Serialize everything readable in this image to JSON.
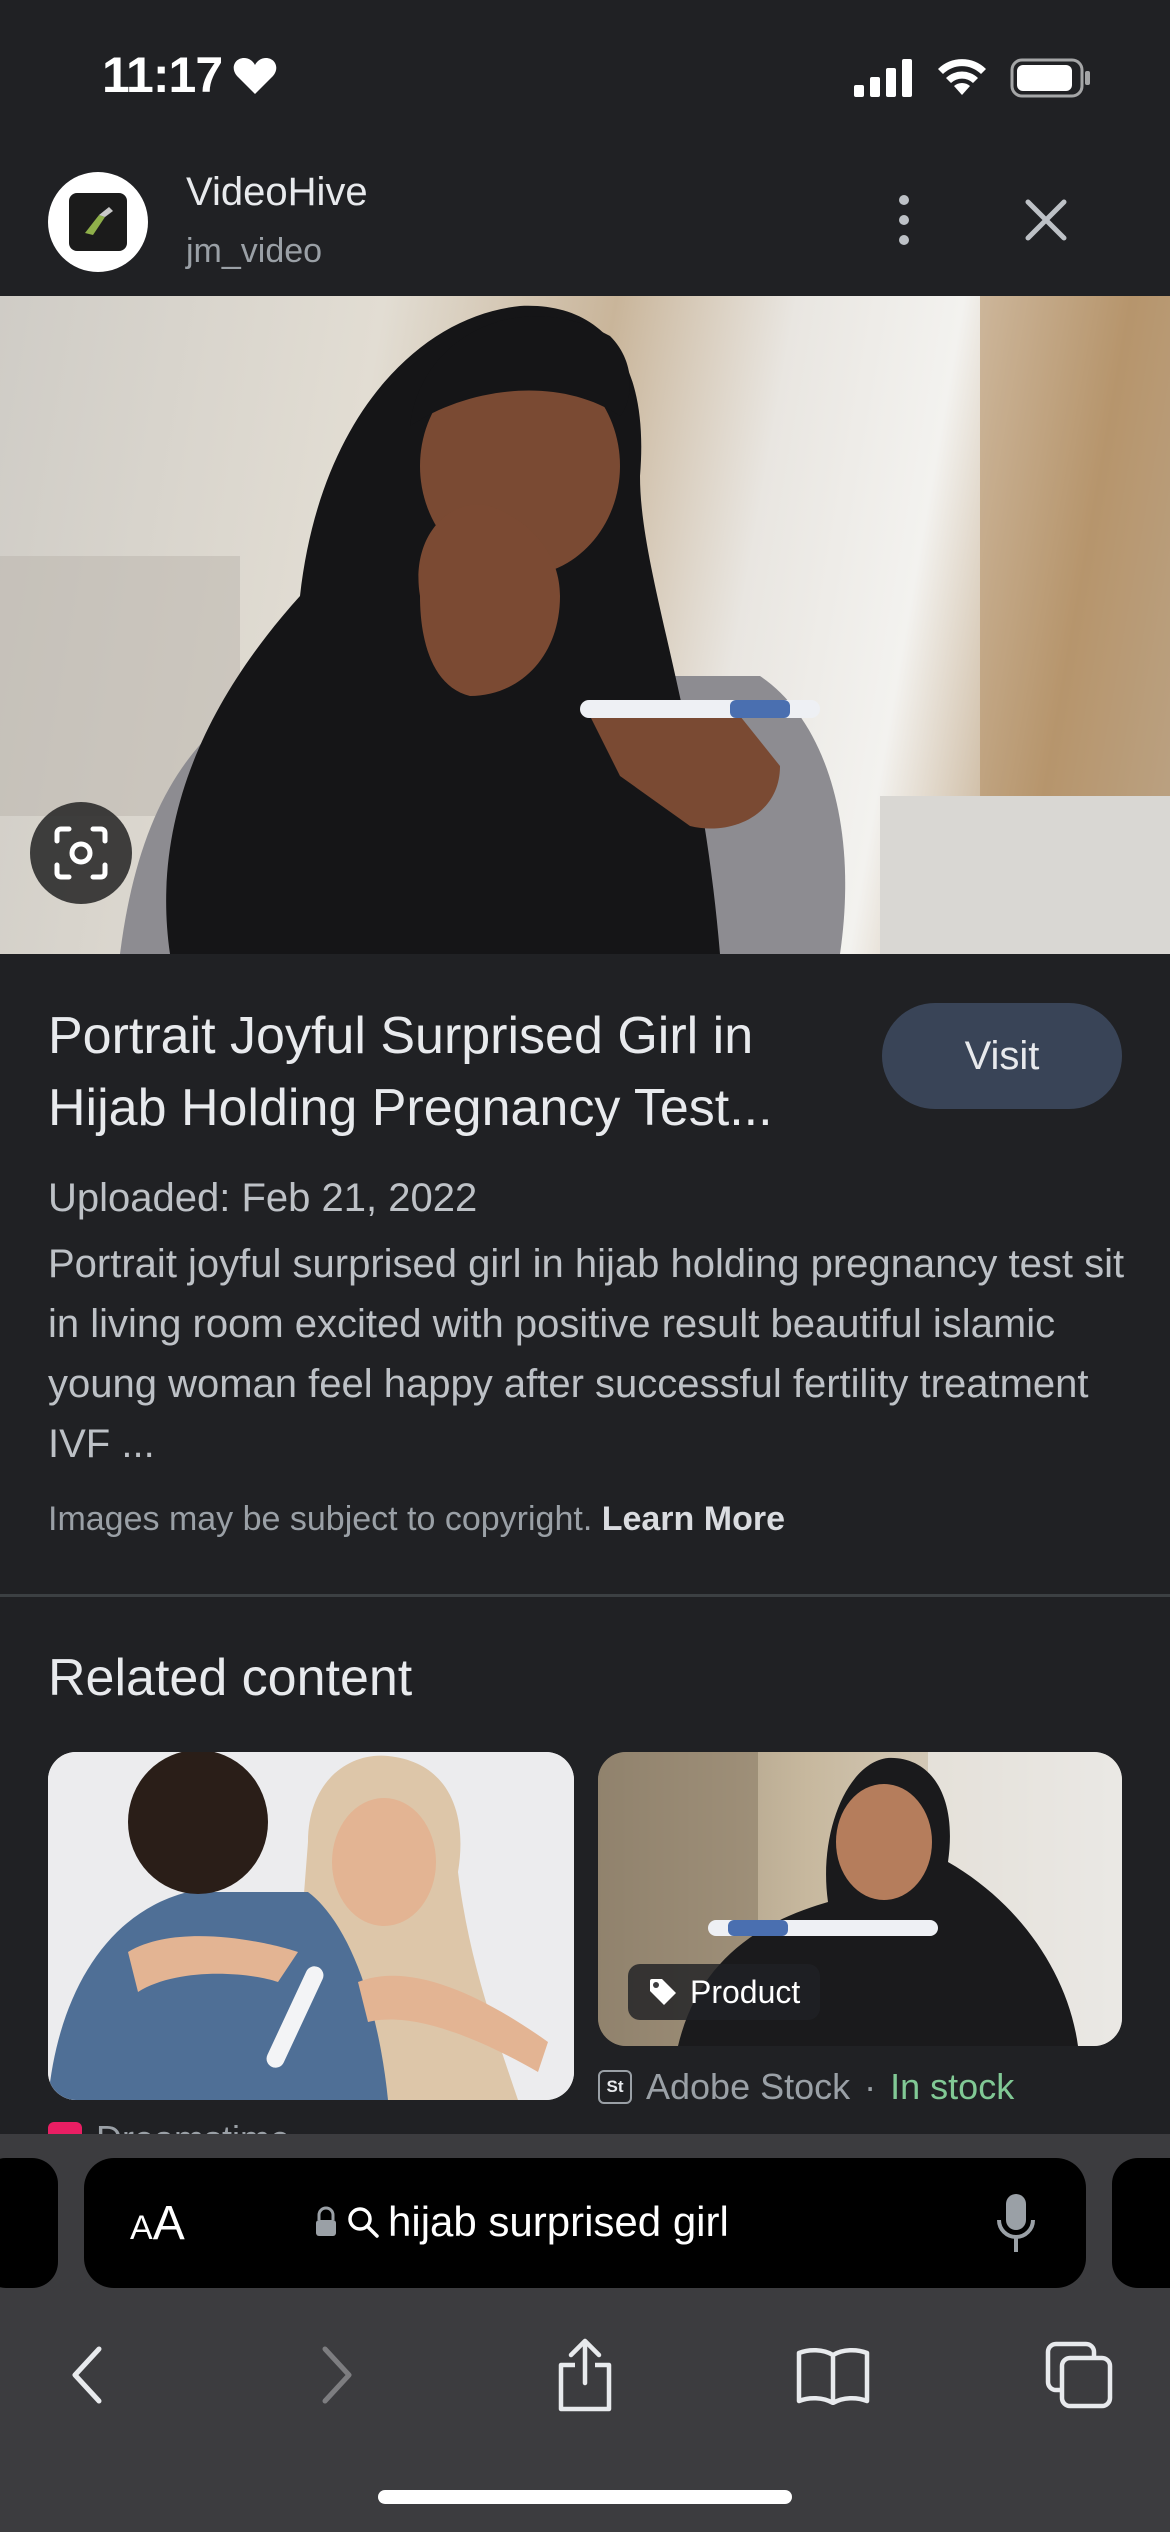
{
  "status_bar": {
    "time": "11:17"
  },
  "source": {
    "name": "VideoHive",
    "handle": "jm_video"
  },
  "result": {
    "title": "Portrait Joyful Surprised Girl in Hijab Holding Pregnancy Test...",
    "visit_label": "Visit",
    "uploaded": "Uploaded: Feb 21, 2022",
    "description": "Portrait joyful surprised girl in hijab holding pregnancy test sit in living room excited with positive result beautiful islamic young woman feel happy after successful fertility treatment IVF ...",
    "copyright_text": "Images may be subject to copyright.",
    "learn_more": "Learn More"
  },
  "related": {
    "heading": "Related content",
    "card2": {
      "badge": "Product",
      "source_icon": "St",
      "source": "Adobe Stock",
      "separator": "·",
      "availability": "In stock"
    },
    "card1": {
      "source": "Dreamstime"
    }
  },
  "browser": {
    "text_size_label_small": "A",
    "text_size_label_large": "A",
    "query": "hijab surprised girl"
  },
  "colors": {
    "background": "#202124",
    "visit_button": "#394457",
    "in_stock": "#81c995",
    "browser_bar": "#3c3c3f"
  }
}
